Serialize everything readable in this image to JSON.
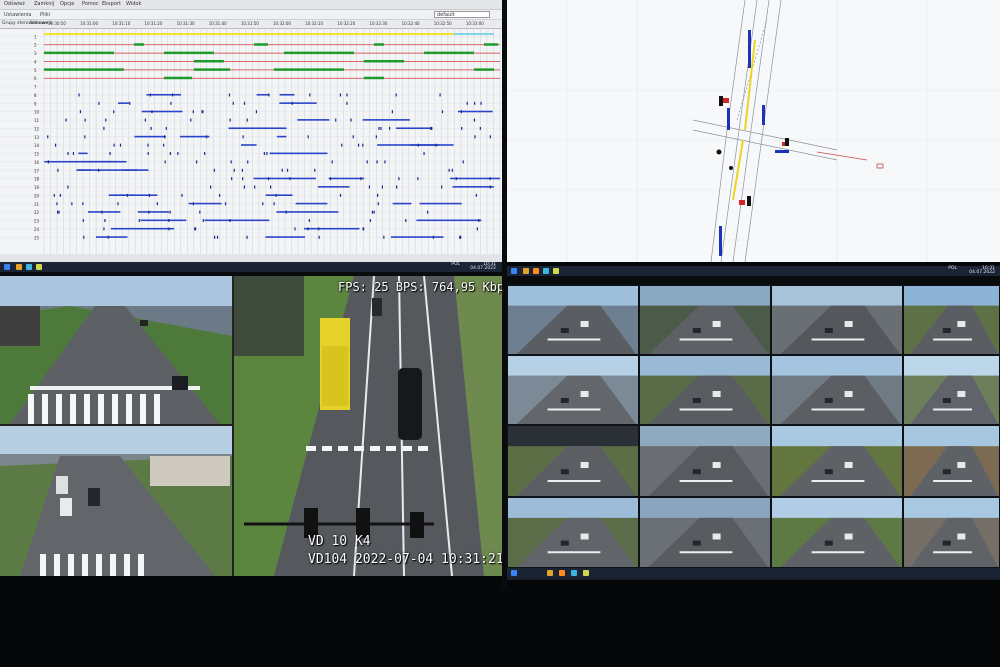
{
  "timeline": {
    "toolbar_items": [
      "Odśwież",
      "Zamknij",
      "Opcje",
      "Pomoc",
      "Eksport",
      "Widok"
    ],
    "menu_items": [
      "Ustawienia",
      "Pliki"
    ],
    "search_value": "default",
    "columns": [
      "Grupy sterownikowe",
      "Sterownik"
    ],
    "time_ticks": [
      "10:30:50",
      "10:31:00",
      "10:31:10",
      "10:31:20",
      "10:31:30",
      "10:31:40",
      "10:31:50",
      "10:32:00",
      "10:32:10",
      "10:32:20",
      "10:32:30",
      "10:32:40",
      "10:32:50",
      "10:33:00"
    ],
    "row_labels": [
      "1",
      "2",
      "3",
      "4",
      "5",
      "6",
      "7",
      "8",
      "9",
      "10",
      "11",
      "12",
      "13",
      "14",
      "15",
      "16",
      "17",
      "18",
      "19",
      "20",
      "21",
      "22",
      "23",
      "24",
      "25"
    ]
  },
  "taskbar_left": {
    "lang": "POL",
    "time": "10:31",
    "date": "04.07.2022"
  },
  "taskbar_right": {
    "lang": "POL",
    "time": "10:31",
    "date": "04.07.2022"
  },
  "camera_main": {
    "fps_text": "FPS: 25 BPS: 764,95 Kbps",
    "cam_name": "VD 10 K4",
    "timestamp": "VD104 2022-07-04 10:31:21"
  },
  "colors": {
    "yellow_bar": "#f1e22b",
    "green_bar": "#1f9a2a",
    "red_line": "#d4353b",
    "blue_bar": "#2a44c8",
    "taskbar": "#1a2434"
  }
}
